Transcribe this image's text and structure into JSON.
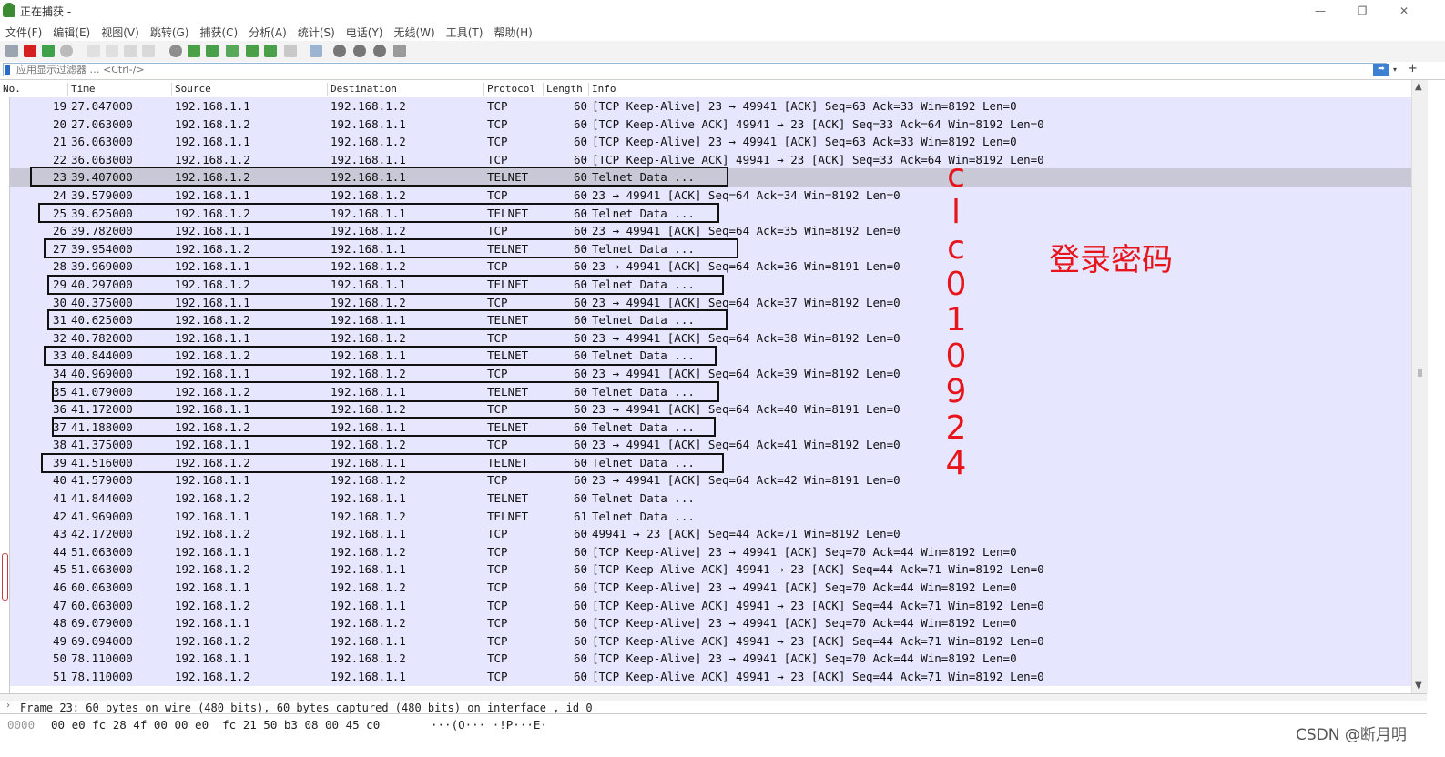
{
  "window": {
    "title": "正在捕获 -",
    "minimize": "—",
    "restore": "❐",
    "close": "✕"
  },
  "menu": [
    "文件(F)",
    "编辑(E)",
    "视图(V)",
    "跳转(G)",
    "捕获(C)",
    "分析(A)",
    "统计(S)",
    "电话(Y)",
    "无线(W)",
    "工具(T)",
    "帮助(H)"
  ],
  "filter": {
    "placeholder": "应用显示过滤器 … <Ctrl-/>",
    "apply": "➡",
    "dropdown": "▾",
    "add": "+"
  },
  "columns": {
    "no": "No.",
    "time": "Time",
    "source": "Source",
    "destination": "Destination",
    "protocol": "Protocol",
    "length": "Length",
    "info": "Info"
  },
  "packets": [
    {
      "no": "19",
      "time": "27.047000",
      "src": "192.168.1.1",
      "dst": "192.168.1.2",
      "proto": "TCP",
      "len": "60",
      "info": "[TCP Keep-Alive] 23 → 49941 [ACK] Seq=63 Ack=33 Win=8192 Len=0"
    },
    {
      "no": "20",
      "time": "27.063000",
      "src": "192.168.1.2",
      "dst": "192.168.1.1",
      "proto": "TCP",
      "len": "60",
      "info": "[TCP Keep-Alive ACK] 49941 → 23 [ACK] Seq=33 Ack=64 Win=8192 Len=0"
    },
    {
      "no": "21",
      "time": "36.063000",
      "src": "192.168.1.1",
      "dst": "192.168.1.2",
      "proto": "TCP",
      "len": "60",
      "info": "[TCP Keep-Alive] 23 → 49941 [ACK] Seq=63 Ack=33 Win=8192 Len=0"
    },
    {
      "no": "22",
      "time": "36.063000",
      "src": "192.168.1.2",
      "dst": "192.168.1.1",
      "proto": "TCP",
      "len": "60",
      "info": "[TCP Keep-Alive ACK] 49941 → 23 [ACK] Seq=33 Ack=64 Win=8192 Len=0"
    },
    {
      "no": "23",
      "time": "39.407000",
      "src": "192.168.1.2",
      "dst": "192.168.1.1",
      "proto": "TELNET",
      "len": "60",
      "info": "Telnet Data ..."
    },
    {
      "no": "24",
      "time": "39.579000",
      "src": "192.168.1.1",
      "dst": "192.168.1.2",
      "proto": "TCP",
      "len": "60",
      "info": "23 → 49941 [ACK] Seq=64 Ack=34 Win=8192 Len=0"
    },
    {
      "no": "25",
      "time": "39.625000",
      "src": "192.168.1.2",
      "dst": "192.168.1.1",
      "proto": "TELNET",
      "len": "60",
      "info": "Telnet Data ..."
    },
    {
      "no": "26",
      "time": "39.782000",
      "src": "192.168.1.1",
      "dst": "192.168.1.2",
      "proto": "TCP",
      "len": "60",
      "info": "23 → 49941 [ACK] Seq=64 Ack=35 Win=8192 Len=0"
    },
    {
      "no": "27",
      "time": "39.954000",
      "src": "192.168.1.2",
      "dst": "192.168.1.1",
      "proto": "TELNET",
      "len": "60",
      "info": "Telnet Data ..."
    },
    {
      "no": "28",
      "time": "39.969000",
      "src": "192.168.1.1",
      "dst": "192.168.1.2",
      "proto": "TCP",
      "len": "60",
      "info": "23 → 49941 [ACK] Seq=64 Ack=36 Win=8191 Len=0"
    },
    {
      "no": "29",
      "time": "40.297000",
      "src": "192.168.1.2",
      "dst": "192.168.1.1",
      "proto": "TELNET",
      "len": "60",
      "info": "Telnet Data ..."
    },
    {
      "no": "30",
      "time": "40.375000",
      "src": "192.168.1.1",
      "dst": "192.168.1.2",
      "proto": "TCP",
      "len": "60",
      "info": "23 → 49941 [ACK] Seq=64 Ack=37 Win=8192 Len=0"
    },
    {
      "no": "31",
      "time": "40.625000",
      "src": "192.168.1.2",
      "dst": "192.168.1.1",
      "proto": "TELNET",
      "len": "60",
      "info": "Telnet Data ..."
    },
    {
      "no": "32",
      "time": "40.782000",
      "src": "192.168.1.1",
      "dst": "192.168.1.2",
      "proto": "TCP",
      "len": "60",
      "info": "23 → 49941 [ACK] Seq=64 Ack=38 Win=8192 Len=0"
    },
    {
      "no": "33",
      "time": "40.844000",
      "src": "192.168.1.2",
      "dst": "192.168.1.1",
      "proto": "TELNET",
      "len": "60",
      "info": "Telnet Data ..."
    },
    {
      "no": "34",
      "time": "40.969000",
      "src": "192.168.1.1",
      "dst": "192.168.1.2",
      "proto": "TCP",
      "len": "60",
      "info": "23 → 49941 [ACK] Seq=64 Ack=39 Win=8192 Len=0"
    },
    {
      "no": "35",
      "time": "41.079000",
      "src": "192.168.1.2",
      "dst": "192.168.1.1",
      "proto": "TELNET",
      "len": "60",
      "info": "Telnet Data ..."
    },
    {
      "no": "36",
      "time": "41.172000",
      "src": "192.168.1.1",
      "dst": "192.168.1.2",
      "proto": "TCP",
      "len": "60",
      "info": "23 → 49941 [ACK] Seq=64 Ack=40 Win=8191 Len=0"
    },
    {
      "no": "37",
      "time": "41.188000",
      "src": "192.168.1.2",
      "dst": "192.168.1.1",
      "proto": "TELNET",
      "len": "60",
      "info": "Telnet Data ..."
    },
    {
      "no": "38",
      "time": "41.375000",
      "src": "192.168.1.1",
      "dst": "192.168.1.2",
      "proto": "TCP",
      "len": "60",
      "info": "23 → 49941 [ACK] Seq=64 Ack=41 Win=8192 Len=0"
    },
    {
      "no": "39",
      "time": "41.516000",
      "src": "192.168.1.2",
      "dst": "192.168.1.1",
      "proto": "TELNET",
      "len": "60",
      "info": "Telnet Data ..."
    },
    {
      "no": "40",
      "time": "41.579000",
      "src": "192.168.1.1",
      "dst": "192.168.1.2",
      "proto": "TCP",
      "len": "60",
      "info": "23 → 49941 [ACK] Seq=64 Ack=42 Win=8191 Len=0"
    },
    {
      "no": "41",
      "time": "41.844000",
      "src": "192.168.1.2",
      "dst": "192.168.1.1",
      "proto": "TELNET",
      "len": "60",
      "info": "Telnet Data ..."
    },
    {
      "no": "42",
      "time": "41.969000",
      "src": "192.168.1.1",
      "dst": "192.168.1.2",
      "proto": "TELNET",
      "len": "61",
      "info": "Telnet Data ..."
    },
    {
      "no": "43",
      "time": "42.172000",
      "src": "192.168.1.2",
      "dst": "192.168.1.1",
      "proto": "TCP",
      "len": "60",
      "info": "49941 → 23 [ACK] Seq=44 Ack=71 Win=8192 Len=0"
    },
    {
      "no": "44",
      "time": "51.063000",
      "src": "192.168.1.1",
      "dst": "192.168.1.2",
      "proto": "TCP",
      "len": "60",
      "info": "[TCP Keep-Alive] 23 → 49941 [ACK] Seq=70 Ack=44 Win=8192 Len=0"
    },
    {
      "no": "45",
      "time": "51.063000",
      "src": "192.168.1.2",
      "dst": "192.168.1.1",
      "proto": "TCP",
      "len": "60",
      "info": "[TCP Keep-Alive ACK] 49941 → 23 [ACK] Seq=44 Ack=71 Win=8192 Len=0"
    },
    {
      "no": "46",
      "time": "60.063000",
      "src": "192.168.1.1",
      "dst": "192.168.1.2",
      "proto": "TCP",
      "len": "60",
      "info": "[TCP Keep-Alive] 23 → 49941 [ACK] Seq=70 Ack=44 Win=8192 Len=0"
    },
    {
      "no": "47",
      "time": "60.063000",
      "src": "192.168.1.2",
      "dst": "192.168.1.1",
      "proto": "TCP",
      "len": "60",
      "info": "[TCP Keep-Alive ACK] 49941 → 23 [ACK] Seq=44 Ack=71 Win=8192 Len=0"
    },
    {
      "no": "48",
      "time": "69.079000",
      "src": "192.168.1.1",
      "dst": "192.168.1.2",
      "proto": "TCP",
      "len": "60",
      "info": "[TCP Keep-Alive] 23 → 49941 [ACK] Seq=70 Ack=44 Win=8192 Len=0"
    },
    {
      "no": "49",
      "time": "69.094000",
      "src": "192.168.1.2",
      "dst": "192.168.1.1",
      "proto": "TCP",
      "len": "60",
      "info": "[TCP Keep-Alive ACK] 49941 → 23 [ACK] Seq=44 Ack=71 Win=8192 Len=0"
    },
    {
      "no": "50",
      "time": "78.110000",
      "src": "192.168.1.1",
      "dst": "192.168.1.2",
      "proto": "TCP",
      "len": "60",
      "info": "[TCP Keep-Alive] 23 → 49941 [ACK] Seq=70 Ack=44 Win=8192 Len=0"
    },
    {
      "no": "51",
      "time": "78.110000",
      "src": "192.168.1.2",
      "dst": "192.168.1.1",
      "proto": "TCP",
      "len": "60",
      "info": "[TCP Keep-Alive ACK] 49941 → 23 [ACK] Seq=44 Ack=71 Win=8192 Len=0"
    }
  ],
  "selected_packet_no": "23",
  "annotation": {
    "chars": [
      "c",
      "l",
      "c",
      "0",
      "1",
      "0",
      "9",
      "2",
      "4"
    ],
    "label": "登录密码",
    "color": "#e8141b"
  },
  "detail": {
    "frame": "Frame 23: 60 bytes on wire (480 bits), 60 bytes captured (480 bits) on interface , id 0"
  },
  "bytes": {
    "offset": "0000",
    "hex": "00 e0 fc 28 4f 00 00 e0  fc 21 50 b3 08 00 45 c0",
    "ascii": "···(O··· ·!P···E·"
  },
  "watermark": "CSDN @断月明"
}
